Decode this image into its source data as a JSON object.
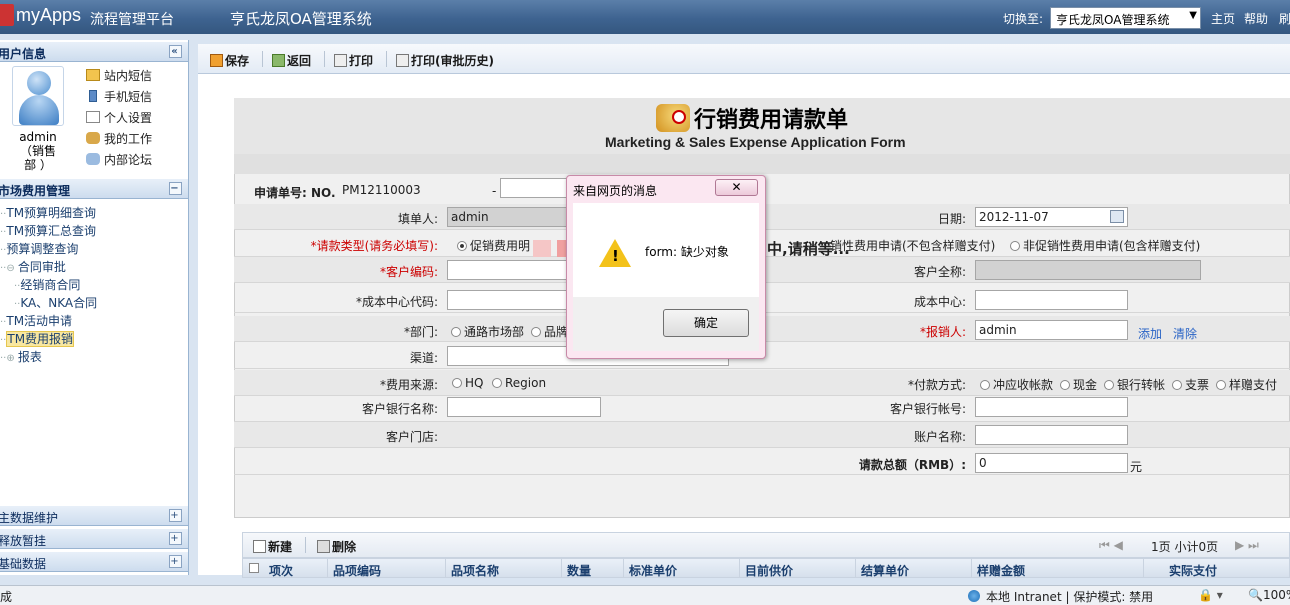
{
  "header": {
    "app_name": "myApps",
    "app_subtitle": "流程管理平台",
    "system_title": "亨氏龙凤OA管理系统",
    "switch_label": "切换至:",
    "switch_value": "亨氏龙凤OA管理系统",
    "home": "主页",
    "help": "帮助",
    "refresh": "刷"
  },
  "sidebar": {
    "user_panel_title": "用户信息",
    "user_name": "admin\n（销售\n部 ）",
    "user_menu": [
      "站内短信",
      "手机短信",
      "个人设置",
      "我的工作",
      "内部论坛"
    ],
    "market_panel_title": "市场费用管理",
    "tree": [
      "TM预算明细查询",
      "TM预算汇总查询",
      "预算调整查询",
      "合同审批",
      "经销商合同",
      "KA、NKA合同",
      "TM活动申请",
      "TM费用报销",
      "报表"
    ],
    "bottom_panels": [
      "主数据维护",
      "释放暂挂",
      "基础数据"
    ]
  },
  "toolbar": {
    "save": "保存",
    "back": "返回",
    "print": "打印",
    "print_history": "打印(审批历史)"
  },
  "form": {
    "title": "行销费用请款单",
    "subtitle": "Marketing & Sales Expense Application Form",
    "req_no_label": "申请单号: NO.",
    "req_no": "PM12110003",
    "dash": "-",
    "filler_label": "填单人:",
    "filler": "admin",
    "date_label": "日期:",
    "date": "2012-11-07",
    "type_label": "*请款类型(请务必填写):",
    "type_opt1": "促销费用明",
    "type_loading": "中,请稍等...",
    "type_opt2": "销性费用申请(不包含样赠支付)",
    "type_opt3": "非促销性费用申请(包含样赠支付)",
    "cust_code_label": "*客户编码:",
    "cust_name_label": "客户全称:",
    "cost_code_label": "*成本中心代码:",
    "cost_center_label": "成本中心:",
    "dept_label": "*部门:",
    "dept_opt1": "通路市场部",
    "dept_opt2": "品牌",
    "reimb_label": "*报销人:",
    "reimb": "admin",
    "add": "添加",
    "clear": "清除",
    "channel_label": "渠道:",
    "source_label": "*费用来源:",
    "source_opt1": "HQ",
    "source_opt2": "Region",
    "pay_label": "*付款方式:",
    "pay_opts": [
      "冲应收帐款",
      "现金",
      "银行转帐",
      "支票",
      "样赠支付"
    ],
    "bank_name_label": "客户银行名称:",
    "bank_acct_label": "客户银行帐号:",
    "store_label": "客户门店:",
    "acct_name_label": "账户名称:",
    "total_label": "请款总额（RMB）:",
    "total": "0",
    "unit": "元"
  },
  "grid": {
    "new": "新建",
    "delete": "删除",
    "pager": "1页 小计0页",
    "columns": [
      "项次",
      "品项编码",
      "品项名称",
      "数量",
      "标准单价",
      "目前供价",
      "结算单价",
      "样赠金额",
      "实际支付"
    ]
  },
  "dialog": {
    "title": "来自网页的消息",
    "message": "form: 缺少对象",
    "ok": "确定"
  },
  "status": {
    "left": "成",
    "zone": "本地 Intranet | 保护模式: 禁用",
    "zoom": "100%"
  },
  "colors": {
    "topbar": "#3e6390",
    "required": "#cc0000",
    "link": "#2a64c6"
  }
}
